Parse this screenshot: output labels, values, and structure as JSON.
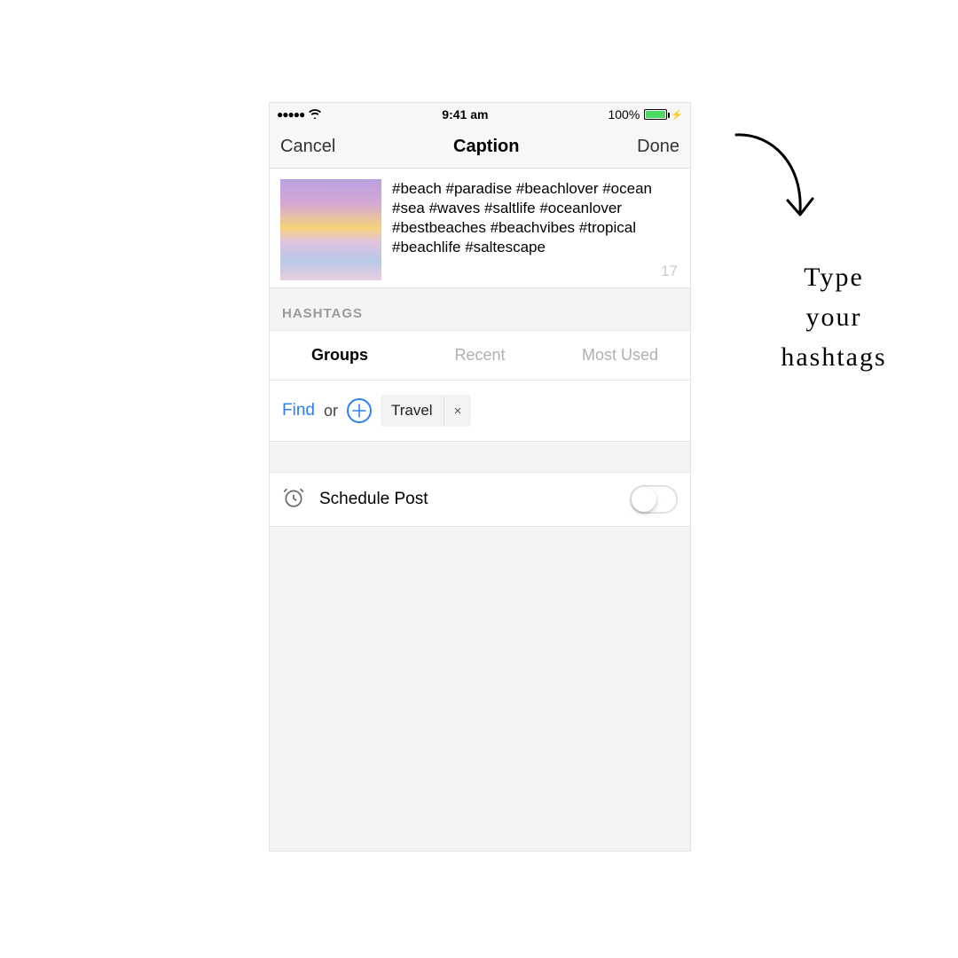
{
  "status": {
    "signal_dots": "●●●●●",
    "time": "9:41 am",
    "battery_percent": "100%"
  },
  "nav": {
    "left": "Cancel",
    "title": "Caption",
    "right": "Done"
  },
  "caption": {
    "text": "#beach #paradise #beachlover #ocean #sea #waves #saltlife #oceanlover #bestbeaches #beachvibes #tropical #beachlife #saltescape",
    "count": "17"
  },
  "sections": {
    "hashtags_header": "HASHTAGS"
  },
  "tabs": {
    "groups": "Groups",
    "recent": "Recent",
    "most_used": "Most Used"
  },
  "find": {
    "find_label": "Find",
    "or_label": "or",
    "chip_label": "Travel",
    "chip_close": "×"
  },
  "schedule": {
    "label": "Schedule Post"
  },
  "annotation": {
    "text_line1": "Type",
    "text_line2": "your",
    "text_line3": "hashtags"
  }
}
